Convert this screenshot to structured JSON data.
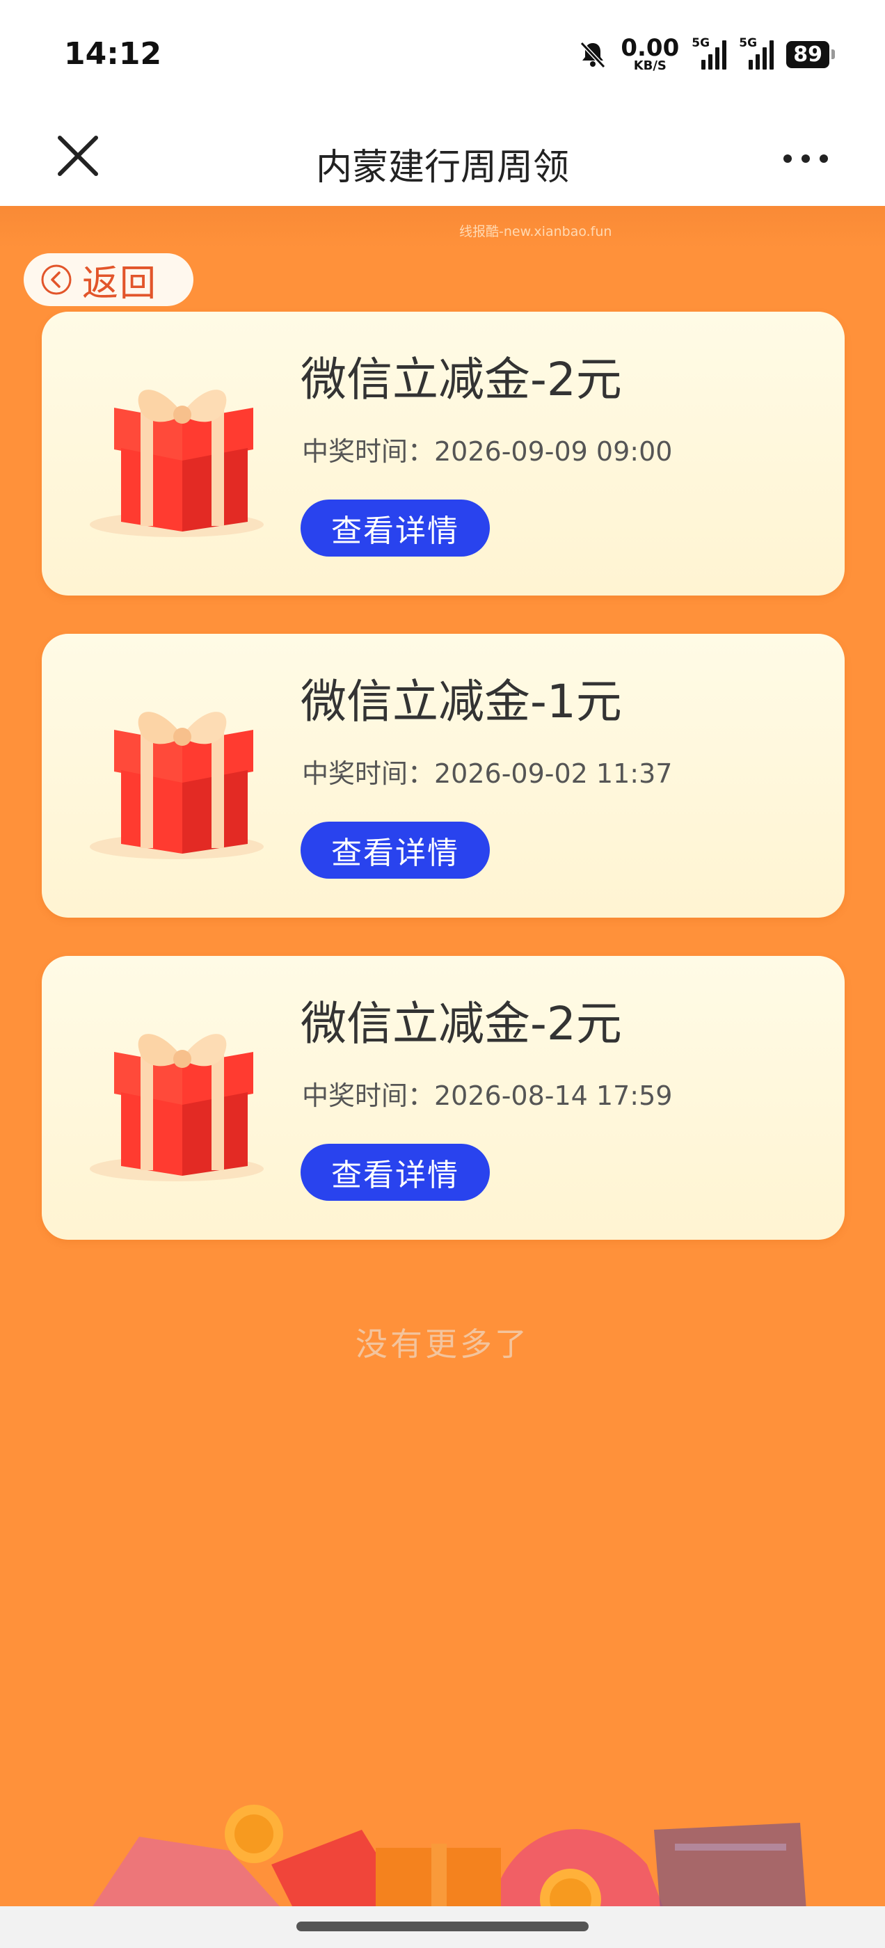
{
  "status_bar": {
    "time": "14:12",
    "net_speed_value": "0.00",
    "net_speed_unit": "KB/S",
    "signal1_label": "5G",
    "signal2_label": "5G",
    "battery": "89",
    "icons": [
      "mute-bell-icon",
      "signal-icon",
      "signal-icon",
      "battery-icon"
    ]
  },
  "nav": {
    "title": "内蒙建行周周领",
    "close_icon": "close-icon",
    "more_icon": "more-icon"
  },
  "watermark": "线报酷-new.xianbao.fun",
  "back_label": "返回",
  "prizes": [
    {
      "title": "微信立减金-2元",
      "time": "中奖时间：2026-09-09 09:00",
      "button": "查看详情"
    },
    {
      "title": "微信立减金-1元",
      "time": "中奖时间：2026-09-02 11:37",
      "button": "查看详情"
    },
    {
      "title": "微信立减金-2元",
      "time": "中奖时间：2026-08-14 17:59",
      "button": "查看详情"
    }
  ],
  "no_more": "没有更多了",
  "colors": {
    "background": "#ff913a",
    "button": "#2943ee",
    "back_text": "#e2552a"
  }
}
